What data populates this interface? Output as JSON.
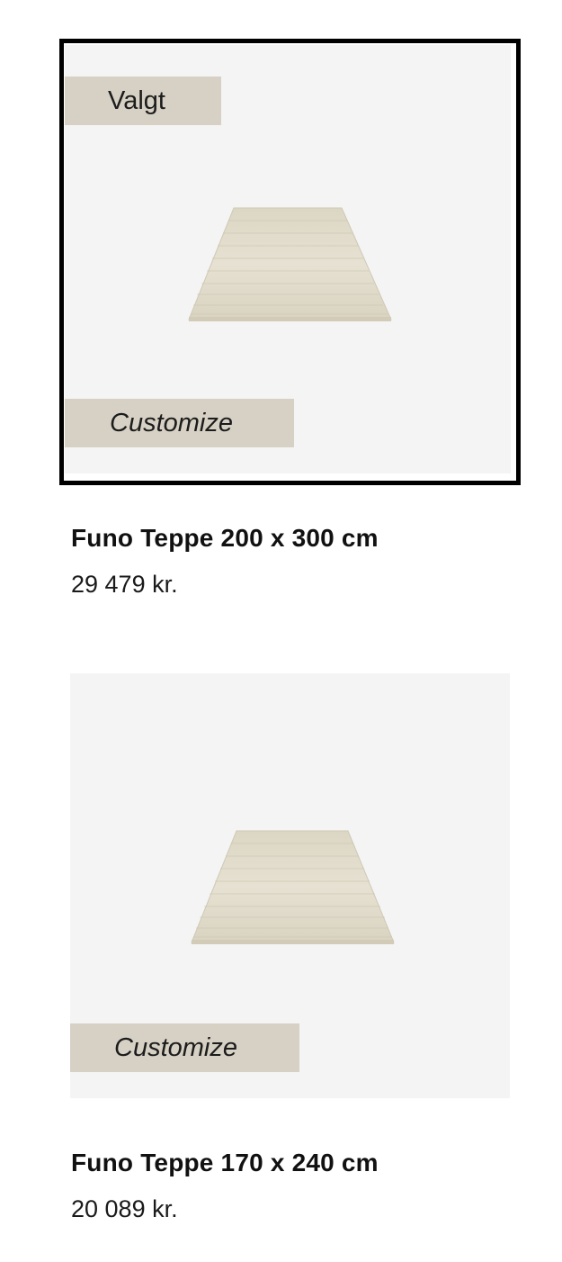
{
  "products": [
    {
      "badge_label": "Valgt",
      "customize_label": "Customize",
      "title": "Funo Teppe 200 x 300 cm",
      "price": "29 479 kr.",
      "image_icon": "rug-image"
    },
    {
      "customize_label": "Customize",
      "title": "Funo Teppe 170 x 240 cm",
      "price": "20 089 kr.",
      "image_icon": "rug-image"
    }
  ],
  "colors": {
    "image_background": "#f4f4f4",
    "badge_background": "#d6d1c4",
    "selected_border": "#000000",
    "rug_color": "#e3ddcb"
  }
}
